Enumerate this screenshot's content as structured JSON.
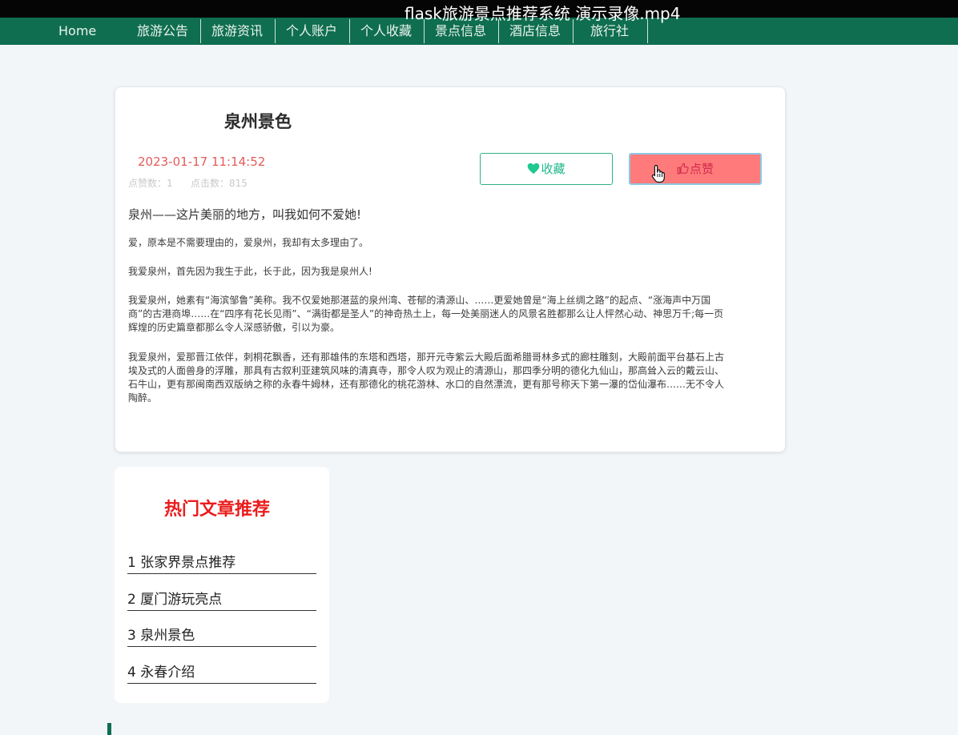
{
  "video": {
    "title": "flask旅游景点推荐系统 演示录像.mp4"
  },
  "nav": {
    "items": [
      {
        "label": "Home"
      },
      {
        "label": "旅游公告"
      },
      {
        "label": "旅游资讯"
      },
      {
        "label": "个人账户"
      },
      {
        "label": "个人收藏"
      },
      {
        "label": "景点信息"
      },
      {
        "label": "酒店信息"
      },
      {
        "label": "旅行社"
      }
    ]
  },
  "article": {
    "title": "泉州景色",
    "date": "2023-01-17 11:14:52",
    "likes_text": "点赞数：1",
    "clicks_text": "点击数：815",
    "favorite_label": "收藏",
    "like_label": "点赞",
    "lead": "泉州——这片美丽的地方，叫我如何不爱她!",
    "paragraphs": [
      "爱，原本是不需要理由的，爱泉州，我却有太多理由了。",
      "我爱泉州，首先因为我生于此，长于此，因为我是泉州人!",
      "我爱泉州，她素有“海滨邹鲁”美称。我不仅爱她那湛蓝的泉州湾、苍郁的清源山、……更爱她曾是“海上丝绸之路”的起点、“涨海声中万国商”的古港商埠……在“四序有花长见雨”、“满街都是圣人”的神奇热土上，每一处美丽迷人的风景名胜都那么让人怦然心动、神思万千;每一页辉煌的历史篇章都那么令人深感骄傲，引以为豪。",
      "我爱泉州，爱那晋江依伴，刺桐花飘香，还有那雄伟的东塔和西塔，那开元寺紫云大殿后面希腊哥林多式的廊柱雕刻，大殿前面平台基石上古埃及式的人面兽身的浮雕，那具有古叙利亚建筑风味的清真寺，那令人叹为观止的清源山，那四季分明的德化九仙山，那高耸入云的戴云山、石牛山，更有那闽南西双版纳之称的永春牛姆林，还有那德化的桃花游林、水口的自然漂流，更有那号称天下第一瀑的岱仙瀑布……无不令人陶醉。"
    ]
  },
  "hot": {
    "title": "热门文章推荐",
    "items": [
      {
        "label": "1 张家界景点推荐"
      },
      {
        "label": "2 厦门游玩亮点"
      },
      {
        "label": "3 泉州景色"
      },
      {
        "label": "4 永春介绍"
      }
    ]
  },
  "colors": {
    "nav_bg": "#0f6e4f",
    "accent_green": "#1fb58a",
    "like_bg": "#ff7b7b",
    "hot_title": "#ea1c1c",
    "date": "#e45a5a"
  },
  "icons": [
    "heart-icon",
    "thumb-up-icon",
    "hand-pointer-icon"
  ]
}
